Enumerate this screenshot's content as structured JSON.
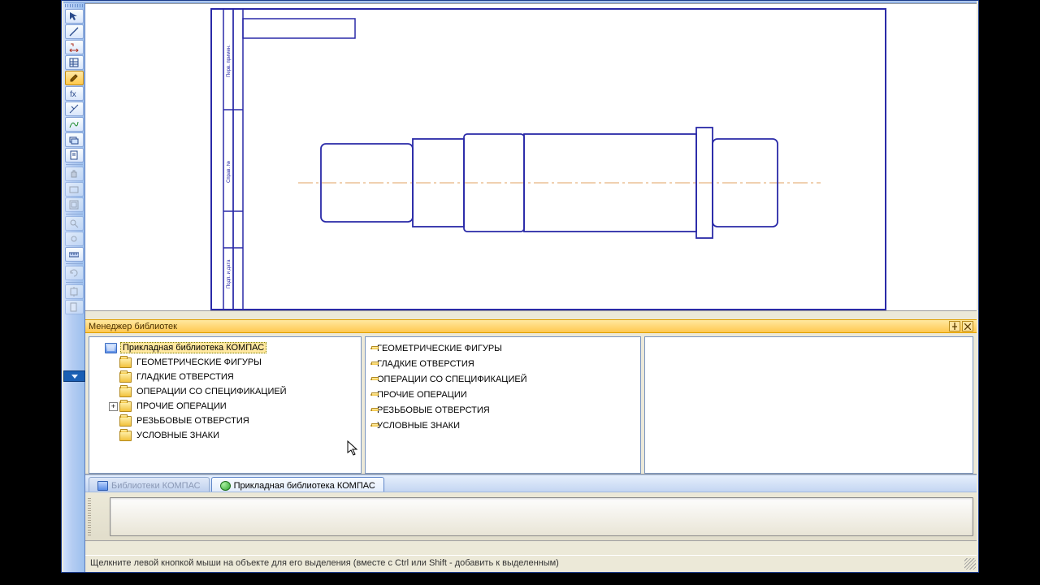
{
  "panel": {
    "title": "Менеджер библиотек",
    "pin_tooltip": "Закрепить",
    "close_tooltip": "Закрыть"
  },
  "tree": {
    "root": "Прикладная библиотека КОМПАС",
    "items": [
      {
        "label": "ГЕОМЕТРИЧЕСКИЕ ФИГУРЫ",
        "expandable": false
      },
      {
        "label": "ГЛАДКИЕ ОТВЕРСТИЯ",
        "expandable": false
      },
      {
        "label": "ОПЕРАЦИИ СО СПЕЦИФИКАЦИЕЙ",
        "expandable": false
      },
      {
        "label": "ПРОЧИЕ ОПЕРАЦИИ",
        "expandable": true
      },
      {
        "label": "РЕЗЬБОВЫЕ ОТВЕРСТИЯ",
        "expandable": false
      },
      {
        "label": "УСЛОВНЫЕ ЗНАКИ",
        "expandable": false
      }
    ]
  },
  "list": [
    "ГЕОМЕТРИЧЕСКИЕ ФИГУРЫ",
    "ГЛАДКИЕ ОТВЕРСТИЯ",
    "ОПЕРАЦИИ СО СПЕЦИФИКАЦИЕЙ",
    "ПРОЧИЕ ОПЕРАЦИИ",
    "РЕЗЬБОВЫЕ ОТВЕРСТИЯ",
    "УСЛОВНЫЕ ЗНАКИ"
  ],
  "tabs": {
    "inactive": "Библиотеки КОМПАС",
    "active": "Прикладная библиотека КОМПАС"
  },
  "status": "Щелкните левой кнопкой мыши на объекте для его выделения (вместе с Ctrl или Shift - добавить к выделенным)",
  "colors": {
    "drawing_stroke": "#2a2aa8",
    "axis": "#e0a060",
    "title_bg": "#ffc850"
  }
}
